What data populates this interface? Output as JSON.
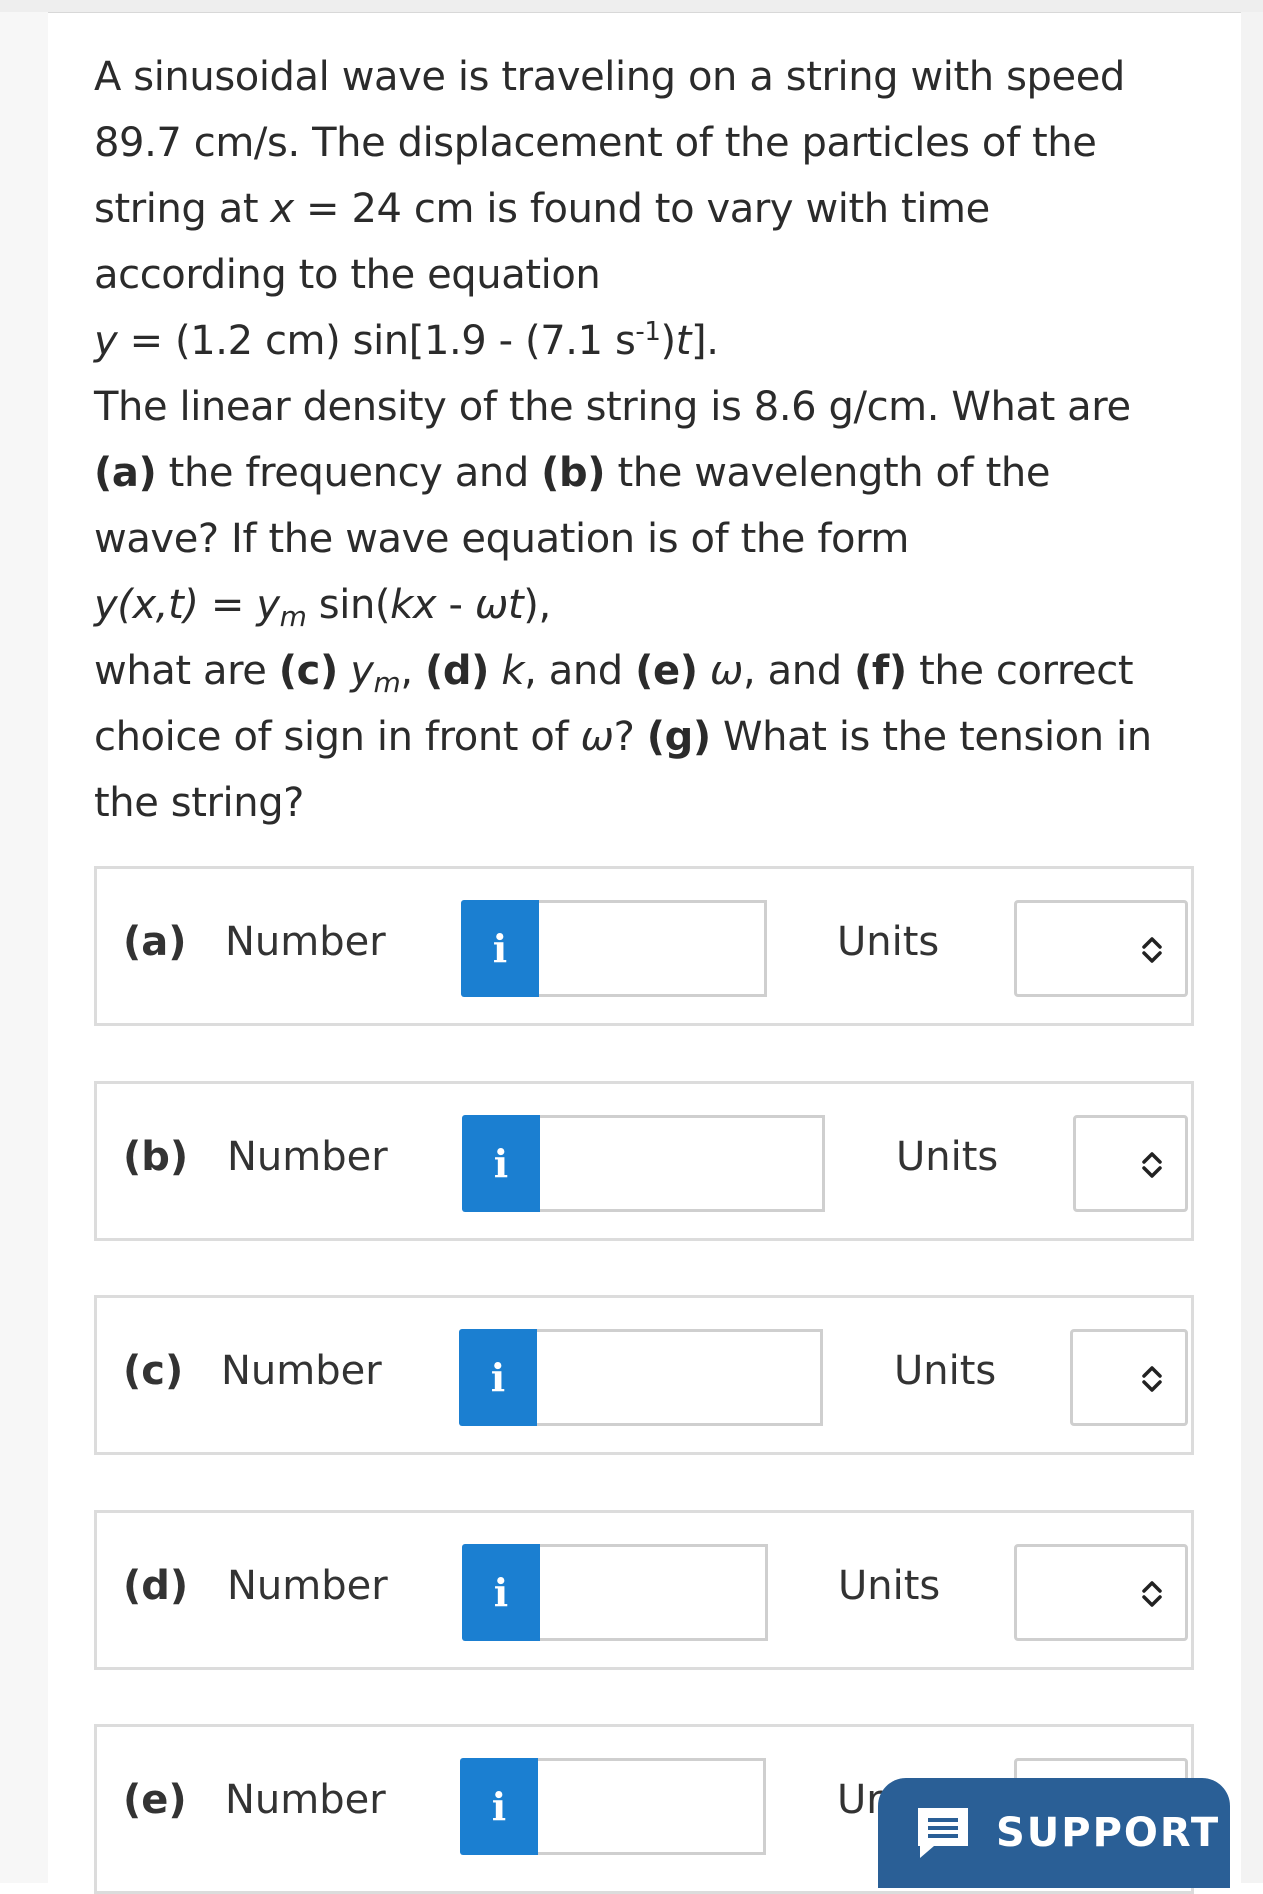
{
  "question": {
    "line1": "A sinusoidal wave is traveling on a string with speed",
    "line2": "89.7 cm/s. The displacement of the particles of the",
    "line3a": "string at ",
    "line3x": "x",
    "line3b": " = 24 cm is found to vary with time",
    "line4": "according to the equation",
    "eq1_pre": "y",
    "eq1_mid": " = (1.2 cm) sin[1.9 - (7.1 s",
    "eq1_sup": "-1",
    "eq1_post": ")",
    "eq1_t": "t",
    "eq1_end": "].",
    "line6": "The linear density of the string is 8.6 g/cm. What are",
    "line7_a": "(a)",
    "line7_b": " the frequency and ",
    "line7_c": "(b)",
    "line7_d": " the wavelength of the",
    "line8": "wave? If the wave equation is of the form",
    "eq2_a": "y(x,t)",
    "eq2_b": " = ",
    "eq2_c": "y",
    "eq2_sub": "m",
    "eq2_d": " sin(",
    "eq2_e": "kx",
    "eq2_f": " - ",
    "eq2_g": "ωt",
    "eq2_h": "),",
    "line10_a": "what are ",
    "line10_b": "(c)",
    "line10_c": " ",
    "line10_y": "y",
    "line10_sub": "m",
    "line10_d": ", ",
    "line10_e": "(d)",
    "line10_f": " ",
    "line10_k": "k",
    "line10_g": ", and ",
    "line10_h": "(e)",
    "line10_i": " ",
    "line10_w": "ω",
    "line10_j": ", and ",
    "line10_k2": "(f)",
    "line10_l": " the correct",
    "line11_a": "choice of sign in front of ",
    "line11_w": "ω",
    "line11_b": "? ",
    "line11_c": "(g)",
    "line11_d": " What is the tension in",
    "line12": "the string?"
  },
  "rows": [
    {
      "part": "(a)",
      "number_label": "Number",
      "info": "i",
      "units_label": "Units"
    },
    {
      "part": "(b)",
      "number_label": "Number",
      "info": "i",
      "units_label": "Units"
    },
    {
      "part": "(c)",
      "number_label": "Number",
      "info": "i",
      "units_label": "Units"
    },
    {
      "part": "(d)",
      "number_label": "Number",
      "info": "i",
      "units_label": "Units"
    },
    {
      "part": "(e)",
      "number_label": "Number",
      "info": "i",
      "units_label": "Ur"
    }
  ],
  "support": {
    "label": "SUPPORT"
  },
  "colors": {
    "info_blue": "#1b7fd1",
    "support_blue": "#2a5f96"
  }
}
